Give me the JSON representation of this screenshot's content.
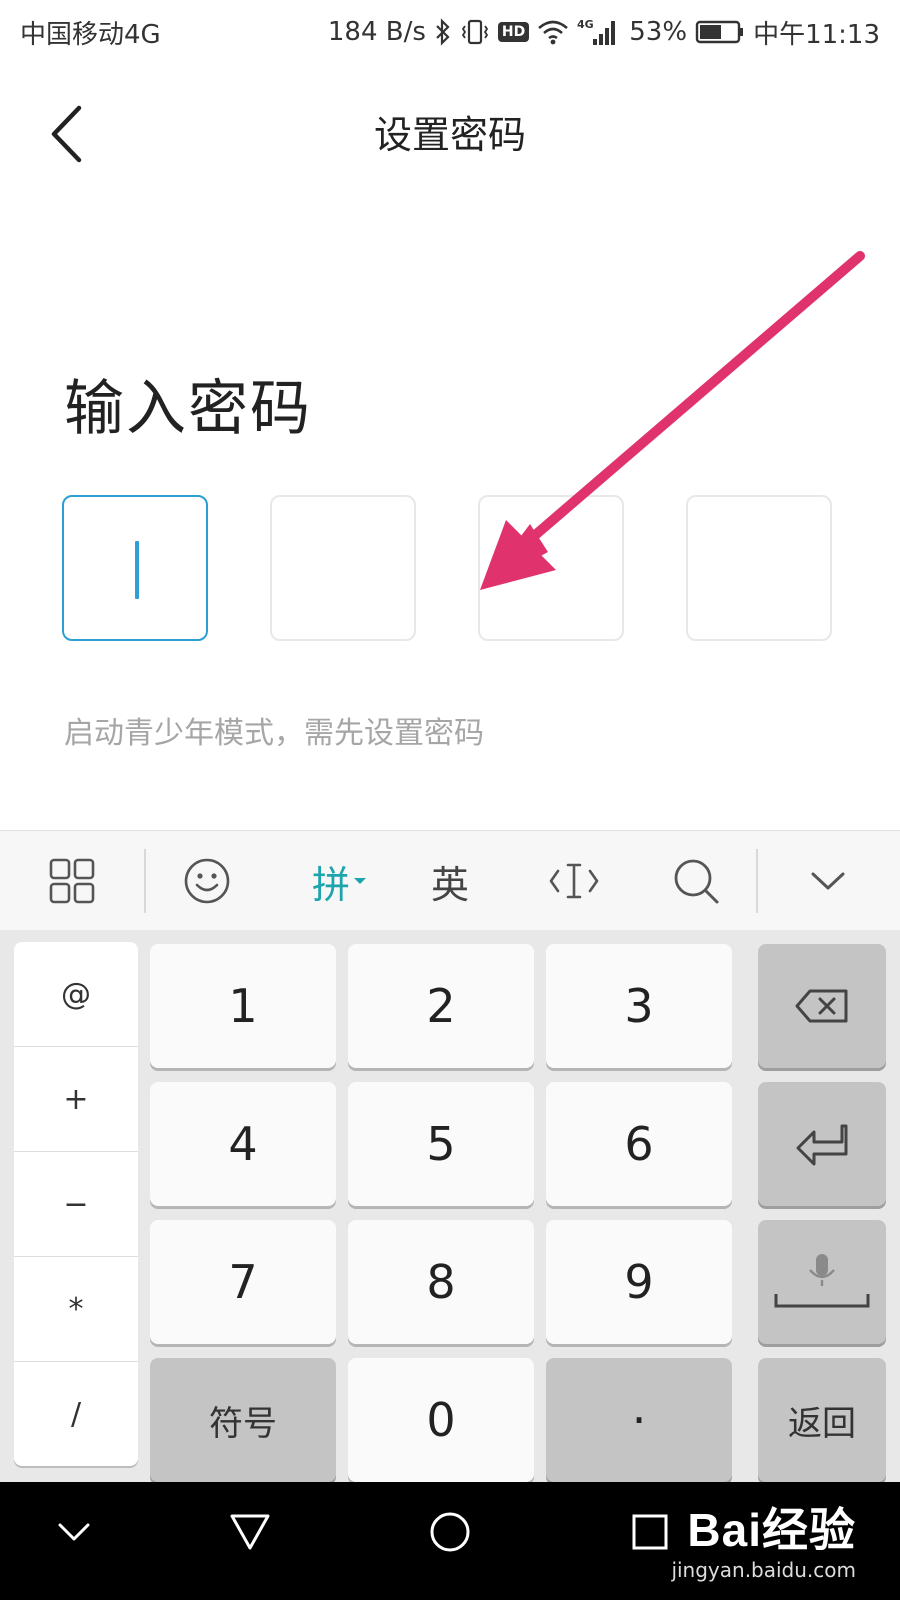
{
  "status_bar": {
    "carrier": "中国移动4G",
    "net_speed": "184 B/s",
    "hd_badge": "HD",
    "network_type": "4G",
    "battery": "53%",
    "time": "中午11:13",
    "icons": [
      "bluetooth-icon",
      "vibrate-icon",
      "hd-icon",
      "wifi-icon",
      "signal-icon",
      "battery-icon"
    ]
  },
  "header": {
    "title": "设置密码",
    "back_icon": "chevron-left-icon"
  },
  "main": {
    "heading": "输入密码",
    "pin_length": 4,
    "pin_active_index": 0,
    "hint": "启动青少年模式，需先设置密码",
    "accent_color": "#2d9fd6",
    "annotation_arrow_color": "#e0336e"
  },
  "keyboard": {
    "toolbar": {
      "items": [
        "grid-menu-icon",
        "emoji-icon",
        "拼",
        "英",
        "cursor-move-icon",
        "search-icon",
        "collapse-keyboard-icon"
      ],
      "pinyin_label": "拼",
      "english_label": "英",
      "active_color": "#1ea4ad"
    },
    "symbols": [
      "@",
      "+",
      "−",
      "*",
      "/"
    ],
    "digits": [
      "1",
      "2",
      "3",
      "4",
      "5",
      "6",
      "7",
      "8",
      "9"
    ],
    "bottom": {
      "symbols_label": "符号",
      "zero": "0",
      "dot": "·",
      "return_label": "返回"
    },
    "side_keys": [
      "backspace-icon",
      "enter-icon",
      "voice-space-icon"
    ]
  },
  "nav_bar": {
    "buttons": [
      "hide-icon",
      "back-triangle-icon",
      "home-circle-icon",
      "recents-square-icon"
    ]
  },
  "watermark": {
    "logo": "Bai经验",
    "url": "jingyan.baidu.com"
  }
}
